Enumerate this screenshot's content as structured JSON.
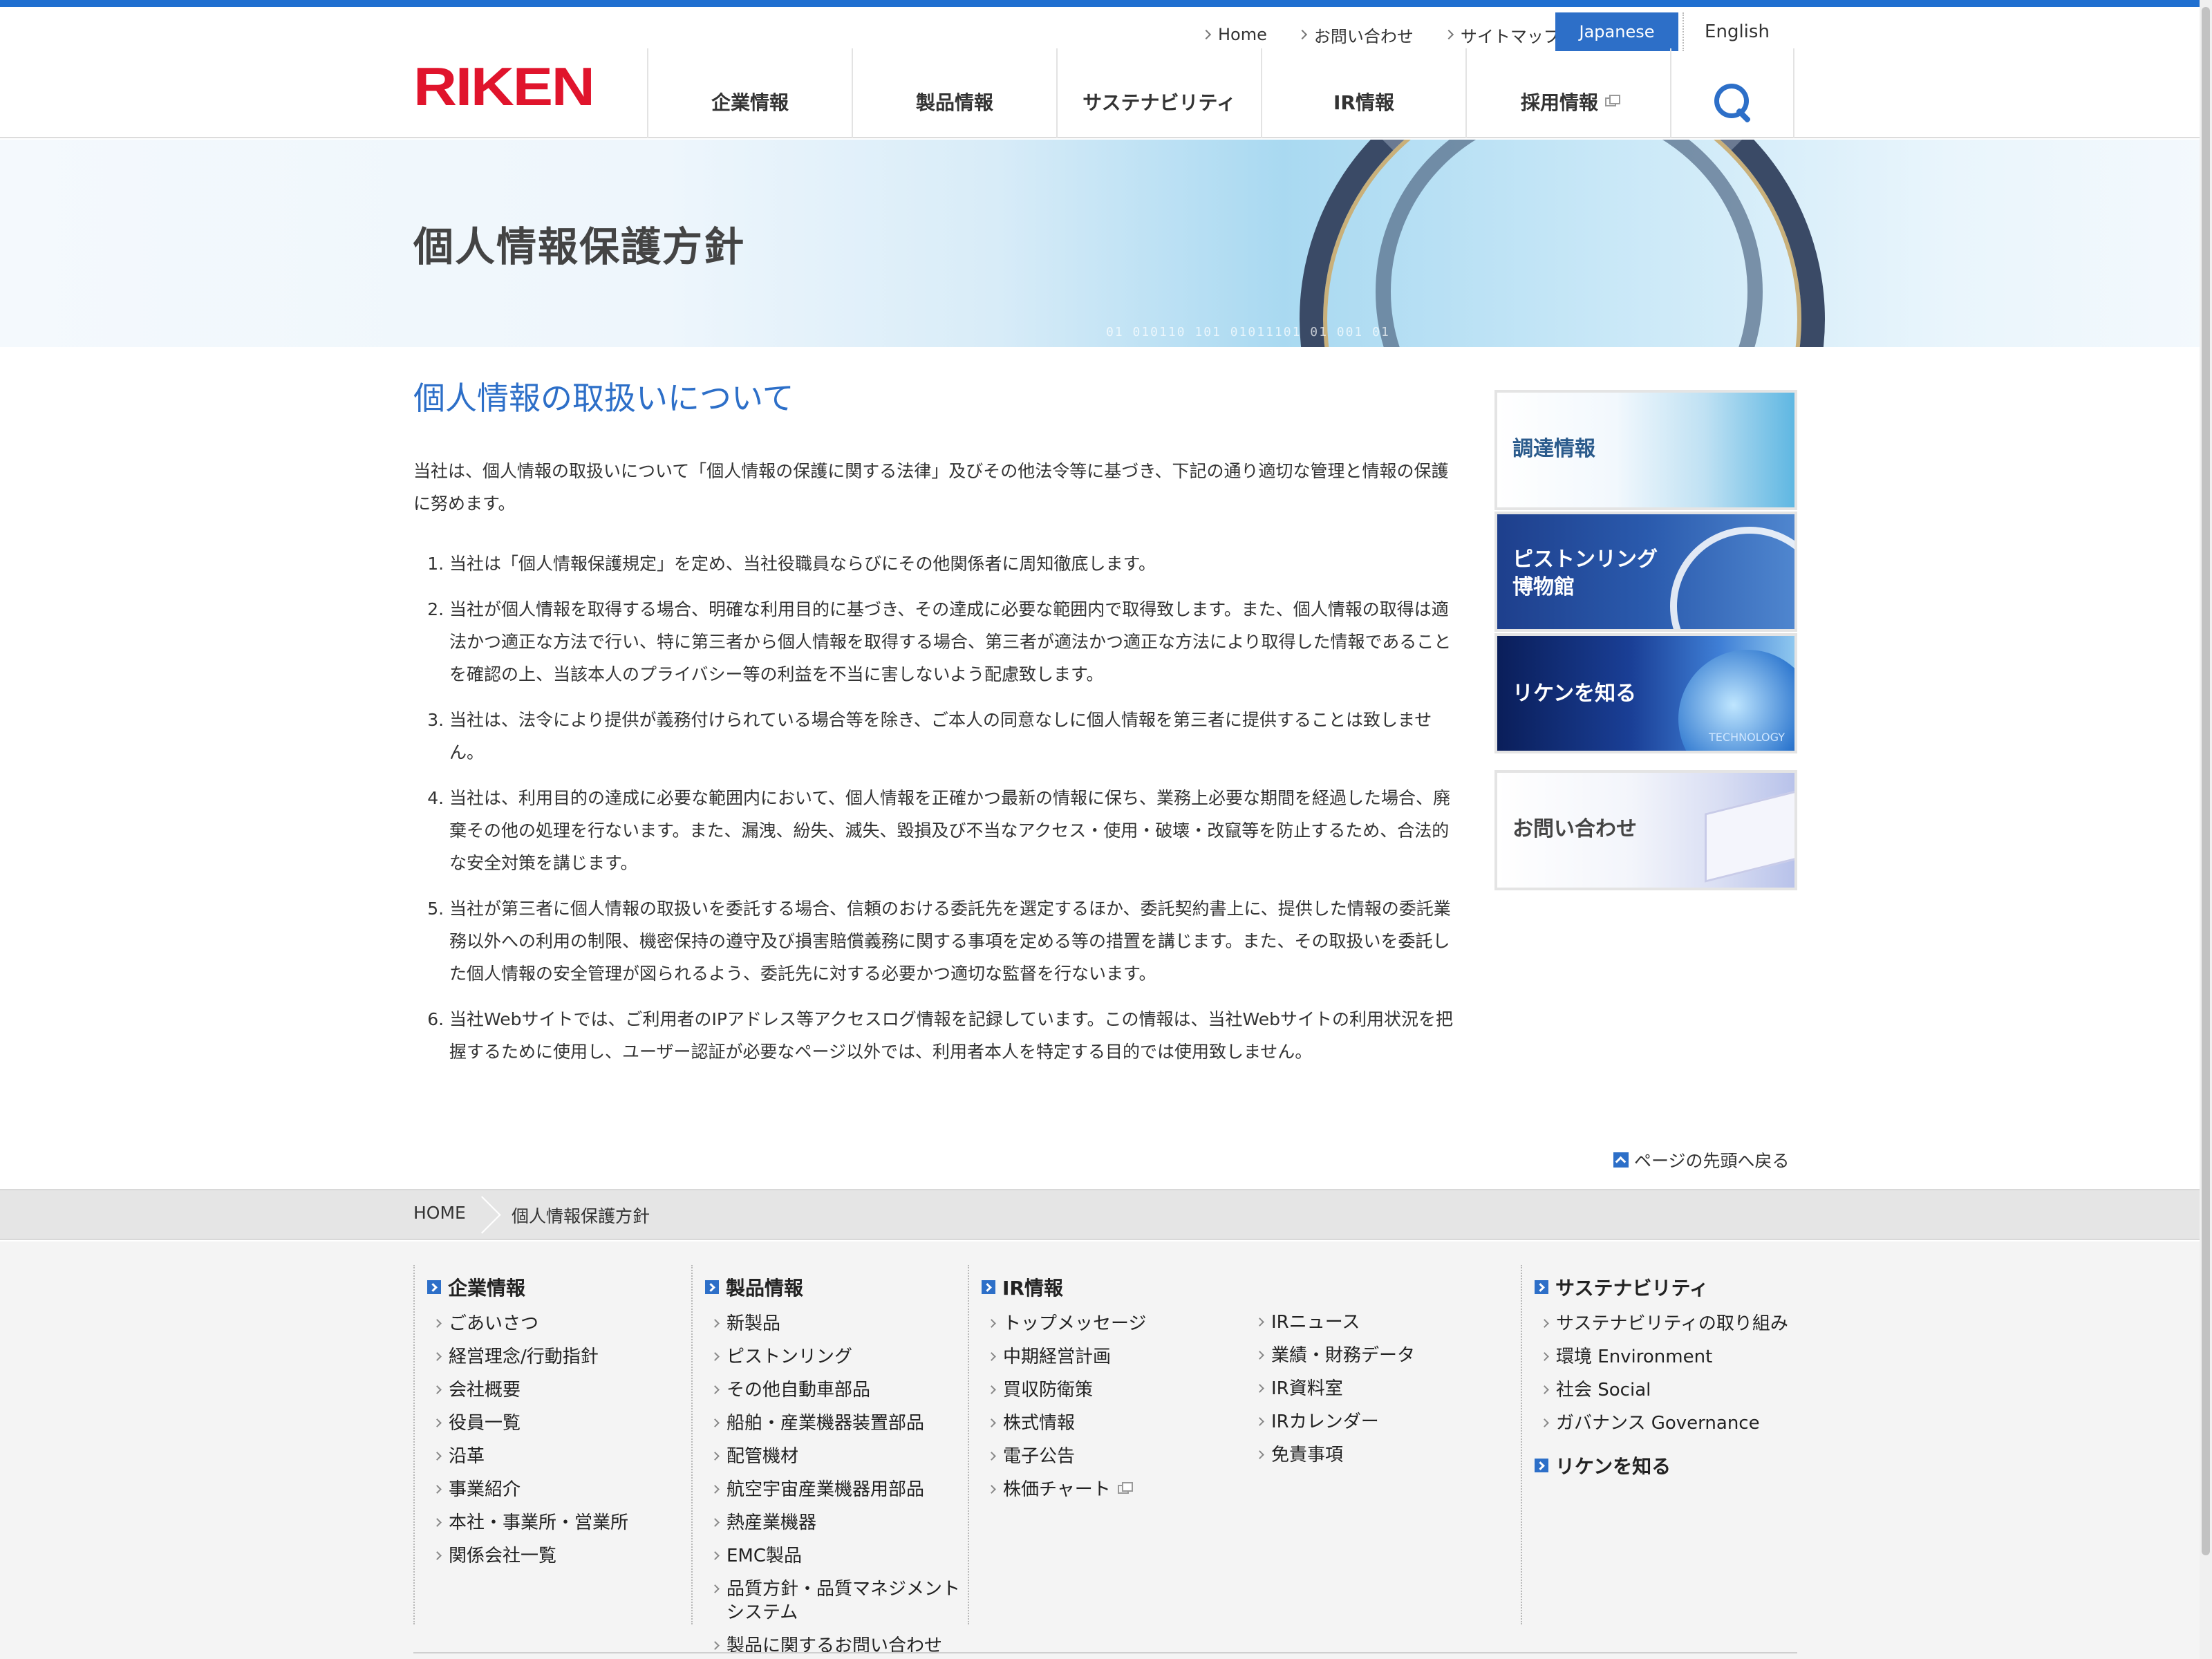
{
  "header": {
    "logo": "RIKEN",
    "utility": [
      "Home",
      "お問い合わせ",
      "サイトマップ"
    ],
    "lang_jp": "Japanese",
    "lang_en": "English",
    "gnav": [
      "企業情報",
      "製品情報",
      "サステナビリティ",
      "IR情報",
      "採用情報"
    ]
  },
  "hero": {
    "title": "個人情報保護方針",
    "code": "01 010110 101 01011101 01 001 01"
  },
  "main": {
    "heading": "個人情報の取扱いについて",
    "intro": "当社は、個人情報の取扱いについて「個人情報の保護に関する法律」及びその他法令等に基づき、下記の通り適切な管理と情報の保護に努めます。",
    "items": [
      "当社は「個人情報保護規定」を定め、当社役職員ならびにその他関係者に周知徹底します。",
      "当社が個人情報を取得する場合、明確な利用目的に基づき、その達成に必要な範囲内で取得致します。また、個人情報の取得は適法かつ適正な方法で行い、特に第三者から個人情報を取得する場合、第三者が適法かつ適正な方法により取得した情報であることを確認の上、当該本人のプライバシー等の利益を不当に害しないよう配慮致します。",
      "当社は、法令により提供が義務付けられている場合等を除き、ご本人の同意なしに個人情報を第三者に提供することは致しません。",
      "当社は、利用目的の達成に必要な範囲内において、個人情報を正確かつ最新の情報に保ち、業務上必要な期間を経過した場合、廃棄その他の処理を行ないます。また、漏洩、紛失、滅失、毀損及び不当なアクセス・使用・破壊・改竄等を防止するため、合法的な安全対策を講じます。",
      "当社が第三者に個人情報の取扱いを委託する場合、信頼のおける委託先を選定するほか、委託契約書上に、提供した情報の委託業務以外への利用の制限、機密保持の遵守及び損害賠償義務に関する事項を定める等の措置を講じます。また、その取扱いを委託した個人情報の安全管理が図られるよう、委託先に対する必要かつ適切な監督を行ないます。",
      "当社Webサイトでは、ご利用者のIPアドレス等アクセスログ情報を記録しています。この情報は、当社Webサイトの利用状況を把握するために使用し、ユーザー認証が必要なページ以外では、利用者本人を特定する目的では使用致しません。"
    ],
    "back_to_top": "ページの先頭へ戻る"
  },
  "side": {
    "procurement": "調達情報",
    "museum_line1": "ピストンリング",
    "museum_line2": "博物館",
    "know": "リケンを知る",
    "know_sub": "TECHNOLOGY",
    "contact": "お問い合わせ"
  },
  "breadcrumb": {
    "home": "HOME",
    "current": "個人情報保護方針"
  },
  "footer": {
    "company": {
      "title": "企業情報",
      "links": [
        "ごあいさつ",
        "経営理念/行動指針",
        "会社概要",
        "役員一覧",
        "沿革",
        "事業紹介",
        "本社・事業所・営業所",
        "関係会社一覧"
      ]
    },
    "products": {
      "title": "製品情報",
      "links": [
        "新製品",
        "ピストンリング",
        "その他自動車部品",
        "船舶・産業機器装置部品",
        "配管機材",
        "航空宇宙産業機器用部品",
        "熱産業機器",
        "EMC製品",
        "品質方針・品質マネジメントシステム",
        "製品に関するお問い合わせ"
      ]
    },
    "ir": {
      "title": "IR情報",
      "links_a": [
        "トップメッセージ",
        "中期経営計画",
        "買収防衛策",
        "株式情報",
        "電子公告",
        "株価チャート"
      ],
      "links_b": [
        "IRニュース",
        "業績・財務データ",
        "IR資料室",
        "IRカレンダー",
        "免責事項"
      ]
    },
    "sustainability": {
      "title": "サステナビリティ",
      "links": [
        "サステナビリティの取り組み",
        "環境 Environment",
        "社会 Social",
        "ガバナンス Governance"
      ]
    },
    "know_riken": "リケンを知る"
  }
}
